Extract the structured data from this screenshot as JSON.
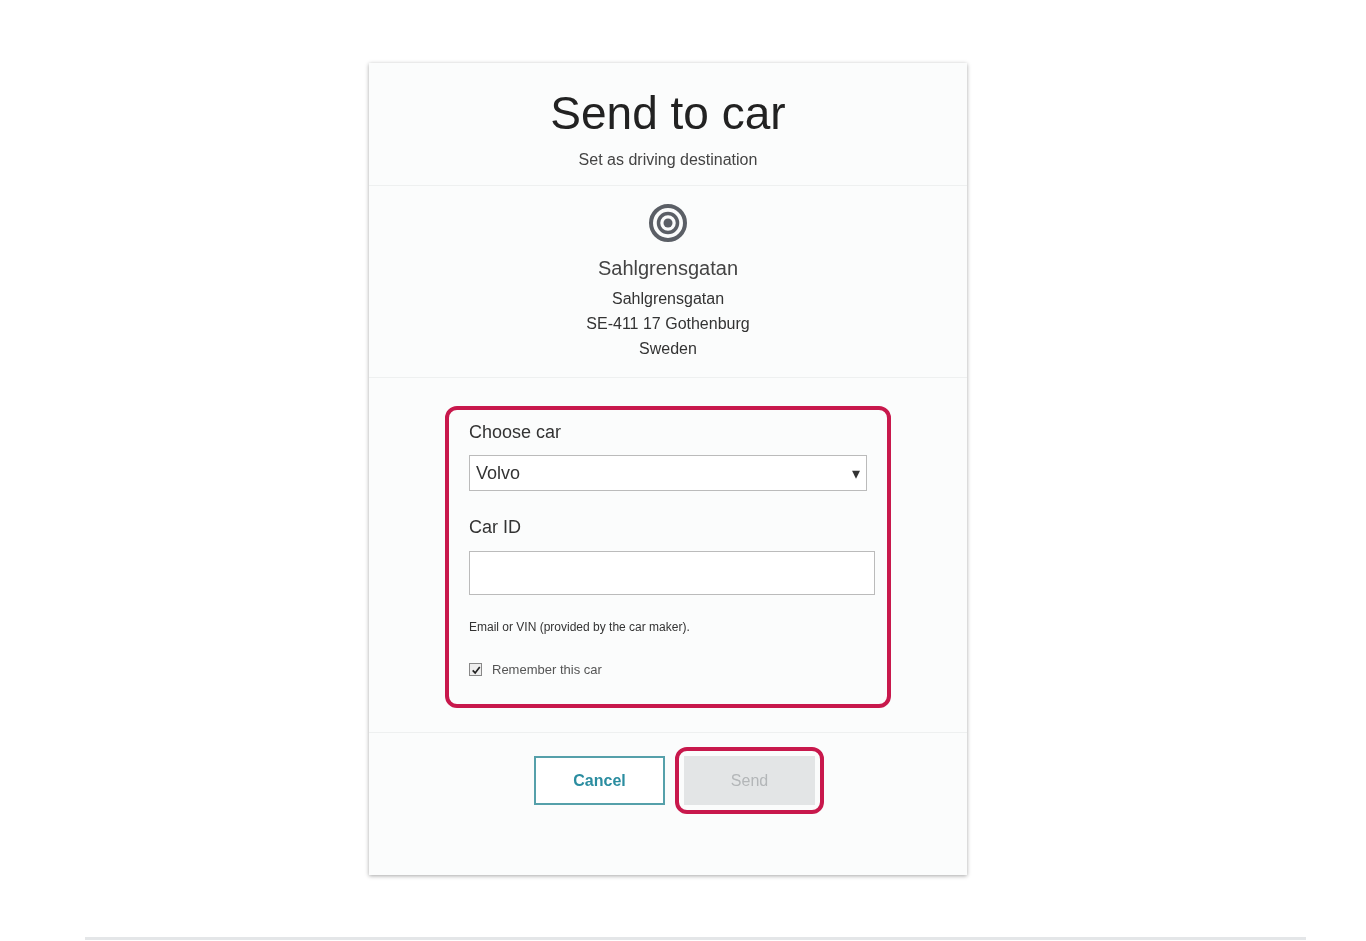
{
  "dialog": {
    "title": "Send to car",
    "subtitle": "Set as driving destination"
  },
  "destination": {
    "name": "Sahlgrensgatan",
    "address_lines": [
      "Sahlgrensgatan",
      "SE-411 17 Gothenburg",
      "Sweden"
    ]
  },
  "form": {
    "highlighted": true,
    "car_label": "Choose car",
    "car_value": "Volvo",
    "id_label": "Car ID",
    "id_hint": "Email or VIN (provided by the car maker).",
    "remember": {
      "label": "Remember this car",
      "checked": true
    }
  },
  "buttons": [
    {
      "label": "Cancel",
      "kind": "secondary",
      "disabled": false,
      "highlighted": false
    },
    {
      "label": "Send",
      "kind": "primary",
      "disabled": true,
      "highlighted": true
    }
  ],
  "dropdown_arrow": "▾"
}
